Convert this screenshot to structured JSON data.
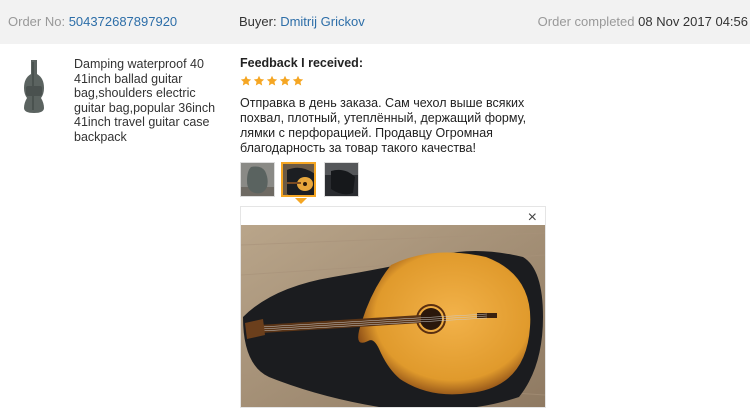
{
  "order": {
    "label": "Order No:",
    "number": "504372687897920"
  },
  "buyer": {
    "label": "Buyer:",
    "name": "Dmitrij Grickov"
  },
  "status": {
    "label": "Order completed",
    "date": "08 Nov 2017 04:56"
  },
  "product": {
    "title": "Damping waterproof 40 41inch ballad guitar bag,shoulders electric guitar bag,popular 36inch 41inch travel guitar case backpack",
    "icon": "guitar-bag-image"
  },
  "feedback": {
    "heading": "Feedback I received:",
    "rating": 5,
    "rating_max": 5,
    "star_color": "#f5a623",
    "text": "Отправка в день заказа. Сам чехол выше всяких похвал, плотный, утеплённый, держащий форму, лямки с перфорацией. Продавцу Огромная благодарность за товар такого качества!",
    "thumbnails": [
      "guitar-bag-photo",
      "guitar-in-case-photo",
      "bag-on-seat-photo"
    ],
    "selected_thumbnail": 1,
    "close_label": "×"
  },
  "colors": {
    "link": "#2d6ea8",
    "header_bg": "#f2f2f2",
    "accent": "#f5a623"
  }
}
